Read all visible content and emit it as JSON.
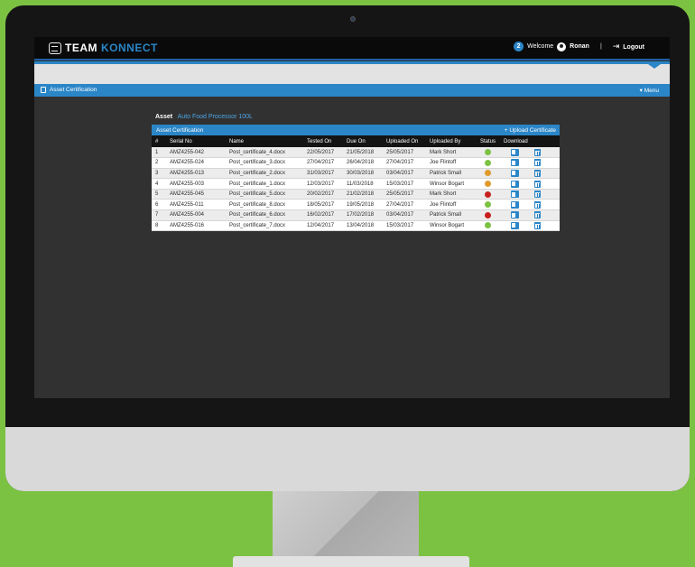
{
  "app": {
    "logo_team": "TEAM",
    "logo_konnect": "KONNECT"
  },
  "user": {
    "badge_count": "2",
    "welcome": "Welcome",
    "name": "Ronan",
    "separator": "|",
    "logout_label": "Logout"
  },
  "menubar": {
    "title": "Asset Certification",
    "menu_label": "▾ Menu"
  },
  "asset": {
    "label": "Asset",
    "value": "Auto Food Processor 100L"
  },
  "panel": {
    "title": "Asset Certification",
    "upload_label": "+ Upload Certificate"
  },
  "colors": {
    "accent": "#2b86c8",
    "status_green": "#7cc242",
    "status_orange": "#e09a2c",
    "status_red": "#c8201e"
  },
  "table": {
    "headers": [
      "#",
      "Serial No",
      "Name",
      "Tested On",
      "Due On",
      "Uploaded On",
      "Uploaded By",
      "Status",
      "Download"
    ],
    "rows": [
      {
        "n": "1",
        "serial": "AMZ4255-042",
        "name": "Post_certificate_4.docx",
        "tested": "22/05/2017",
        "due": "21/05/2018",
        "uploaded": "25/05/2017",
        "by": "Mark Short",
        "status": "green"
      },
      {
        "n": "2",
        "serial": "AMZ4255-024",
        "name": "Post_certificate_3.docx",
        "tested": "27/04/2017",
        "due": "26/04/2018",
        "uploaded": "27/04/2017",
        "by": "Joe Flintoff",
        "status": "green"
      },
      {
        "n": "3",
        "serial": "AMZ4255-013",
        "name": "Post_certificate_2.docx",
        "tested": "31/03/2017",
        "due": "30/03/2018",
        "uploaded": "03/04/2017",
        "by": "Patrick Small",
        "status": "orange"
      },
      {
        "n": "4",
        "serial": "AMZ4255-003",
        "name": "Post_certificate_1.docx",
        "tested": "12/03/2017",
        "due": "11/03/2018",
        "uploaded": "15/03/2017",
        "by": "Winsor Bogart",
        "status": "orange"
      },
      {
        "n": "5",
        "serial": "AMZ4255-045",
        "name": "Post_certificate_5.docx",
        "tested": "20/02/2017",
        "due": "21/02/2018",
        "uploaded": "25/05/2017",
        "by": "Mark Short",
        "status": "red"
      },
      {
        "n": "6",
        "serial": "AMZ4255-011",
        "name": "Post_certificate_8.docx",
        "tested": "18/05/2017",
        "due": "19/05/2018",
        "uploaded": "27/04/2017",
        "by": "Joe Flintoff",
        "status": "green"
      },
      {
        "n": "7",
        "serial": "AMZ4255-004",
        "name": "Post_certificate_6.docx",
        "tested": "16/02/2017",
        "due": "17/02/2018",
        "uploaded": "03/04/2017",
        "by": "Patrick Small",
        "status": "red"
      },
      {
        "n": "8",
        "serial": "AMZ4255-016",
        "name": "Post_certificate_7.docx",
        "tested": "12/04/2017",
        "due": "13/04/2018",
        "uploaded": "15/03/2017",
        "by": "Winsor Bogart",
        "status": "green"
      }
    ]
  }
}
